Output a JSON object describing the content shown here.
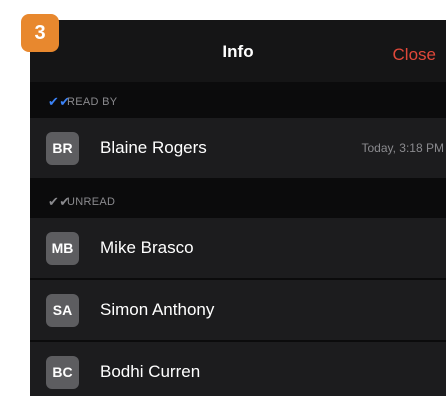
{
  "step_badge": "3",
  "nav": {
    "title": "Info",
    "close_label": "Close"
  },
  "sections": {
    "read_by": {
      "icon": "double-check-icon",
      "icon_glyph": "✔✔",
      "icon_color": "#3b82f6",
      "label": "READ BY"
    },
    "unread": {
      "icon": "double-check-icon",
      "icon_glyph": "✔✔",
      "icon_color": "#8a8a8e",
      "label": "UNREAD"
    }
  },
  "read_by": [
    {
      "initials": "BR",
      "name": "Blaine Rogers",
      "time": "Today, 3:18 PM"
    }
  ],
  "unread": [
    {
      "initials": "MB",
      "name": "Mike Brasco"
    },
    {
      "initials": "SA",
      "name": "Simon Anthony"
    },
    {
      "initials": "BC",
      "name": "Bodhi Curren"
    }
  ],
  "colors": {
    "accent_close": "#e0483a",
    "badge": "#e8882e",
    "row_bg": "#1c1c1e",
    "screen_bg": "#0b0b0c"
  }
}
